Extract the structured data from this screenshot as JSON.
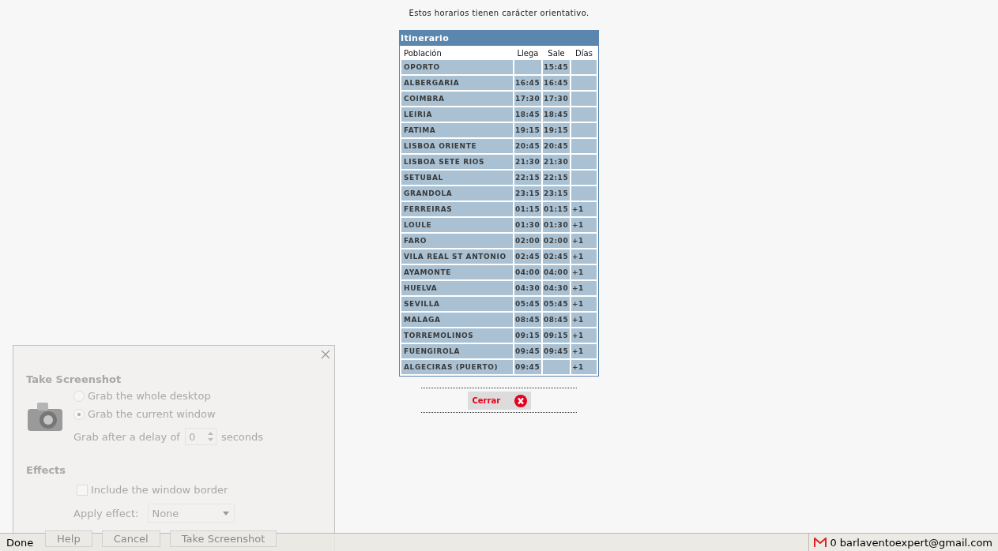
{
  "notice": "Estos horarios tienen carácter orientativo.",
  "itinerary": {
    "title": "Itinerario",
    "columns": [
      "Población",
      "Llega",
      "Sale",
      "Días"
    ],
    "rows": [
      {
        "town": "OPORTO",
        "arrives": "",
        "departs": "15:45",
        "days": ""
      },
      {
        "town": "ALBERGARIA",
        "arrives": "16:45",
        "departs": "16:45",
        "days": ""
      },
      {
        "town": "COIMBRA",
        "arrives": "17:30",
        "departs": "17:30",
        "days": ""
      },
      {
        "town": "LEIRIA",
        "arrives": "18:45",
        "departs": "18:45",
        "days": ""
      },
      {
        "town": "FATIMA",
        "arrives": "19:15",
        "departs": "19:15",
        "days": ""
      },
      {
        "town": "LISBOA ORIENTE",
        "arrives": "20:45",
        "departs": "20:45",
        "days": ""
      },
      {
        "town": "LISBOA SETE RIOS",
        "arrives": "21:30",
        "departs": "21:30",
        "days": ""
      },
      {
        "town": "SETUBAL",
        "arrives": "22:15",
        "departs": "22:15",
        "days": ""
      },
      {
        "town": "GRANDOLA",
        "arrives": "23:15",
        "departs": "23:15",
        "days": ""
      },
      {
        "town": "FERREIRAS",
        "arrives": "01:15",
        "departs": "01:15",
        "days": "+1"
      },
      {
        "town": "LOULE",
        "arrives": "01:30",
        "departs": "01:30",
        "days": "+1"
      },
      {
        "town": "FARO",
        "arrives": "02:00",
        "departs": "02:00",
        "days": "+1"
      },
      {
        "town": "VILA REAL ST ANTONIO",
        "arrives": "02:45",
        "departs": "02:45",
        "days": "+1"
      },
      {
        "town": "AYAMONTE",
        "arrives": "04:00",
        "departs": "04:00",
        "days": "+1"
      },
      {
        "town": "HUELVA",
        "arrives": "04:30",
        "departs": "04:30",
        "days": "+1"
      },
      {
        "town": "SEVILLA",
        "arrives": "05:45",
        "departs": "05:45",
        "days": "+1"
      },
      {
        "town": "MALAGA",
        "arrives": "08:45",
        "departs": "08:45",
        "days": "+1"
      },
      {
        "town": "TORREMOLINOS",
        "arrives": "09:15",
        "departs": "09:15",
        "days": "+1"
      },
      {
        "town": "FUENGIROLA",
        "arrives": "09:45",
        "departs": "09:45",
        "days": "+1"
      },
      {
        "town": "ALGECIRAS (PUERTO)",
        "arrives": "09:45",
        "departs": "",
        "days": "+1"
      }
    ]
  },
  "close_button": {
    "label": "Cerrar"
  },
  "screenshot_dialog": {
    "title": "Take Screenshot",
    "options": [
      {
        "label": "Grab the whole desktop",
        "selected": false
      },
      {
        "label": "Grab the current window",
        "selected": true
      }
    ],
    "delay": {
      "label": "Grab after a delay of",
      "value": "0",
      "unit": "seconds"
    },
    "effects_title": "Effects",
    "include_border": {
      "label": "Include the window border",
      "checked": false
    },
    "apply_effect": {
      "label": "Apply effect:",
      "value": "None"
    },
    "buttons": [
      "Help",
      "Cancel",
      "Take Screenshot"
    ]
  },
  "status_bar": {
    "text": "Done",
    "mail": {
      "count": "0",
      "account": "barlaventoexpert@gmail.com"
    }
  }
}
